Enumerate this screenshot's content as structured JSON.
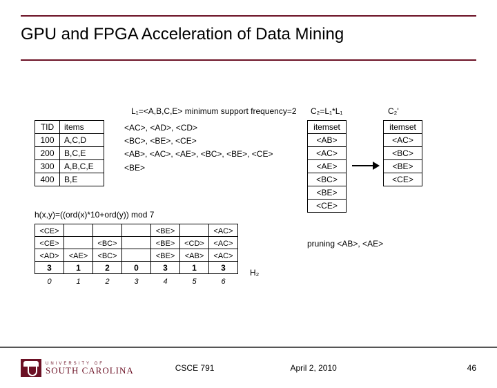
{
  "slide": {
    "title": "GPU and FPGA Acceleration of Data Mining",
    "course": "CSCE 791",
    "date": "April 2, 2010",
    "page": "46"
  },
  "logo": {
    "top": "UNIVERSITY OF",
    "main": "SOUTH CAROLINA"
  },
  "fig": {
    "l1_label": "L₁=<A,B,C,E>  minimum support frequency=2",
    "c2_label": "C₂=L₁*L₁",
    "c2p_label": "C₂'",
    "hash_fn": "h(x,y)=((ord(x)*10+ord(y)) mod 7",
    "h2_label": "H₂",
    "prune_label": "pruning <AB>, <AE>",
    "tid_headers": [
      "TID",
      "items"
    ],
    "tid_rows": [
      [
        "100",
        "A,C,D"
      ],
      [
        "200",
        "B,C,E"
      ],
      [
        "300",
        "A,B,C,E"
      ],
      [
        "400",
        "B,E"
      ]
    ],
    "pairs": [
      "<AC>, <AD>, <CD>",
      "<BC>, <BE>, <CE>",
      "<AB>, <AC>, <AE>, <BC>, <BE>, <CE>",
      "<BE>"
    ],
    "itemset_header": "itemset",
    "c2": [
      "<AB>",
      "<AC>",
      "<AE>",
      "<BC>",
      "<BE>",
      "<CE>"
    ],
    "c2p": [
      "<AC>",
      "<BC>",
      "<BE>",
      "<CE>"
    ],
    "hash_cells": [
      [
        "<CE>",
        "",
        "",
        "",
        "<BE>",
        "",
        "<AC>"
      ],
      [
        "<CE>",
        "",
        "<BC>",
        "",
        "<BE>",
        "<CD>",
        "<AC>"
      ],
      [
        "<AD>",
        "<AE>",
        "<BC>",
        "",
        "<BE>",
        "<AB>",
        "<AC>"
      ]
    ],
    "hash_counts": [
      "3",
      "1",
      "2",
      "0",
      "3",
      "1",
      "3"
    ],
    "hash_labels": [
      "0",
      "1",
      "2",
      "3",
      "4",
      "5",
      "6"
    ]
  }
}
